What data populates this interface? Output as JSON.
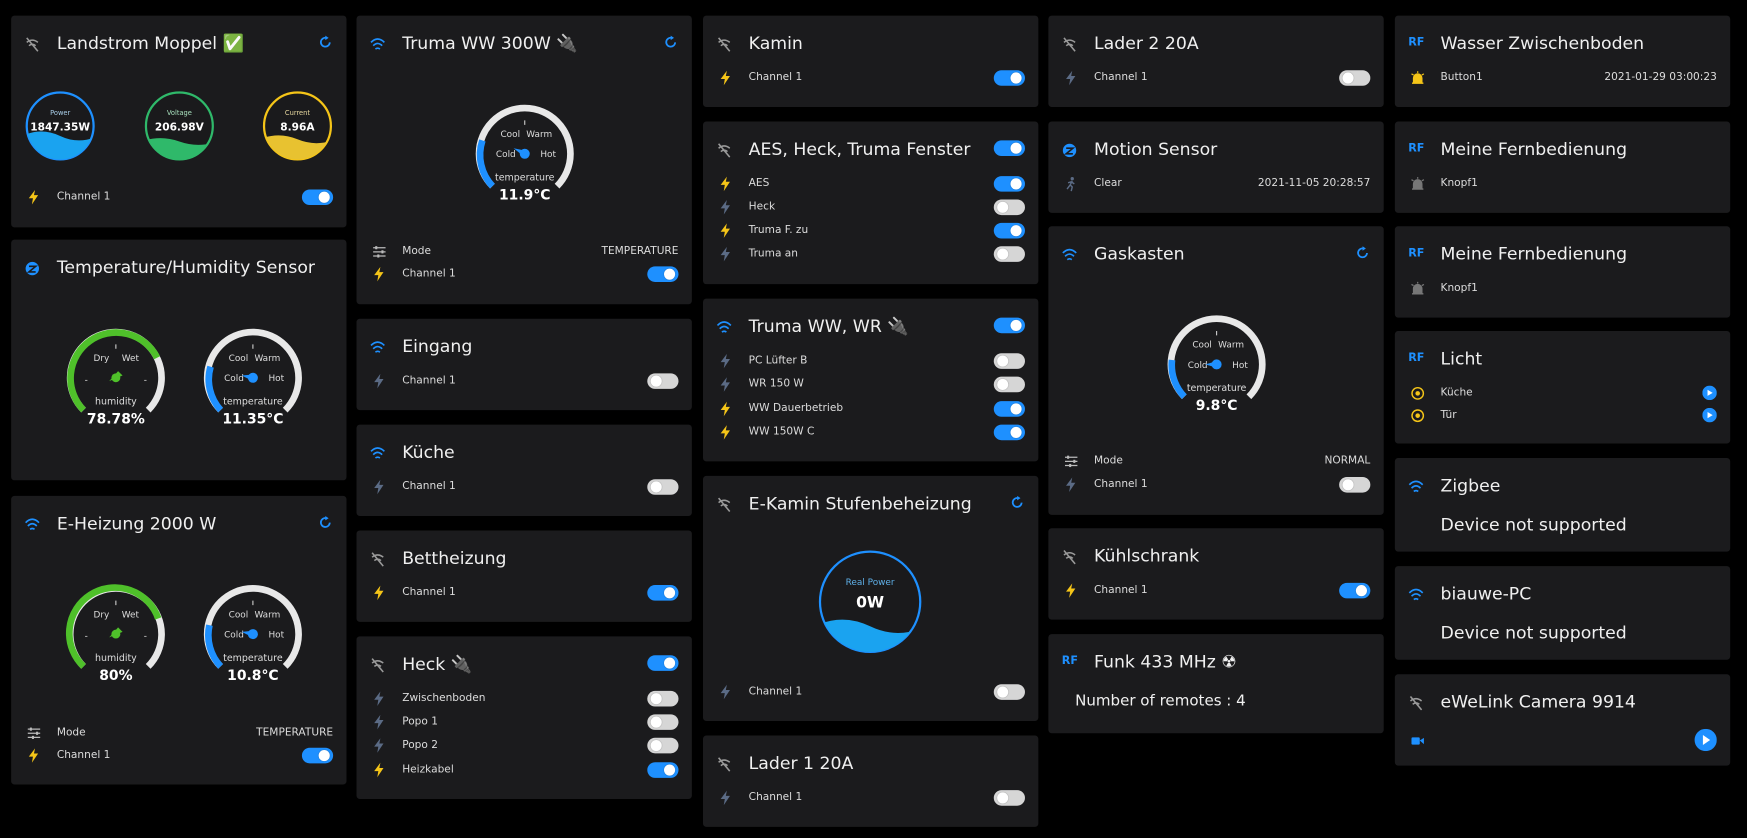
{
  "colors": {
    "accent": "#1e90ff",
    "bolt": "#f5c518",
    "card": "#1b1b1d",
    "toggle_off": "#d6d6d6"
  },
  "cards": {
    "landstrom": {
      "title": "Landstrom Moppel ✅",
      "power_label": "Power",
      "power_value": "1847.35W",
      "voltage_label": "Voltage",
      "voltage_value": "206.98V",
      "current_label": "Current",
      "current_value": "8.96A",
      "channel": "Channel 1",
      "channel_on": true
    },
    "temphum": {
      "title": "Temperature/Humidity Sensor",
      "hum_dry": "Dry",
      "hum_wet": "Wet",
      "hum_label": "humidity",
      "hum_value": "78.78%",
      "t_cool": "Cool",
      "t_warm": "Warm",
      "t_cold": "Cold",
      "t_hot": "Hot",
      "t_label": "temperature",
      "t_value": "11.35°C"
    },
    "eheizung": {
      "title": "E-Heizung 2000 W",
      "hum_dry": "Dry",
      "hum_wet": "Wet",
      "hum_label": "humidity",
      "hum_value": "80%",
      "t_cool": "Cool",
      "t_warm": "Warm",
      "t_cold": "Cold",
      "t_hot": "Hot",
      "t_label": "temperature",
      "t_value": "10.8°C",
      "mode_label": "Mode",
      "mode_value": "TEMPERATURE",
      "channel": "Channel 1",
      "channel_on": true
    },
    "truma300": {
      "title": "Truma WW 300W 🔌",
      "t_cool": "Cool",
      "t_warm": "Warm",
      "t_cold": "Cold",
      "t_hot": "Hot",
      "t_label": "temperature",
      "t_value": "11.9°C",
      "mode_label": "Mode",
      "mode_value": "TEMPERATURE",
      "channel": "Channel 1",
      "channel_on": true
    },
    "eingang": {
      "title": "Eingang",
      "channel": "Channel 1",
      "channel_on": false
    },
    "kueche": {
      "title": "Küche",
      "channel": "Channel 1",
      "channel_on": false
    },
    "bettheizung": {
      "title": "Bettheizung",
      "channel": "Channel 1",
      "channel_on": true
    },
    "heck": {
      "title": "Heck 🔌",
      "master_on": true,
      "channels": [
        {
          "label": "Zwischenboden",
          "on": false
        },
        {
          "label": "Popo 1",
          "on": false
        },
        {
          "label": "Popo 2",
          "on": false
        },
        {
          "label": "Heizkabel",
          "on": true
        }
      ]
    },
    "kamin": {
      "title": "Kamin",
      "channel": "Channel 1",
      "channel_on": true
    },
    "aes": {
      "title": "AES, Heck, Truma Fenster",
      "master_on": true,
      "channels": [
        {
          "label": "AES",
          "on": true
        },
        {
          "label": "Heck",
          "on": false
        },
        {
          "label": "Truma F. zu",
          "on": true
        },
        {
          "label": "Truma an",
          "on": false
        }
      ]
    },
    "trumawr": {
      "title": "Truma WW, WR 🔌",
      "master_on": true,
      "channels": [
        {
          "label": "PC Lüfter B",
          "on": false
        },
        {
          "label": "WR 150 W",
          "on": false
        },
        {
          "label": "WW Dauerbetrieb",
          "on": true
        },
        {
          "label": "WW 150W C",
          "on": true
        }
      ]
    },
    "ekamin": {
      "title": "E-Kamin Stufenbeheizung",
      "power_label": "Real Power",
      "power_value": "0W",
      "channel": "Channel 1",
      "channel_on": false
    },
    "lader1": {
      "title": "Lader 1 20A",
      "channel": "Channel 1",
      "channel_on": false
    },
    "lader2": {
      "title": "Lader 2 20A",
      "channel": "Channel 1",
      "channel_on": false
    },
    "motion": {
      "title": "Motion Sensor",
      "status": "Clear",
      "time": "2021-11-05 20:28:57"
    },
    "gaskasten": {
      "title": "Gaskasten",
      "t_cool": "Cool",
      "t_warm": "Warm",
      "t_cold": "Cold",
      "t_hot": "Hot",
      "t_label": "temperature",
      "t_value": "9.8°C",
      "mode_label": "Mode",
      "mode_value": "NORMAL",
      "channel": "Channel 1",
      "channel_on": false
    },
    "kuehlschrank": {
      "title": "Kühlschrank",
      "channel": "Channel 1",
      "channel_on": true
    },
    "funk": {
      "title": "Funk 433 MHz ☢",
      "remotes_text": "Number of remotes : 4"
    },
    "wasser": {
      "title": "Wasser Zwischenboden",
      "button": "Button1",
      "time": "2021-01-29 03:00:23"
    },
    "fern1": {
      "title": "Meine Fernbedienung",
      "button": "Knopf1"
    },
    "fern2": {
      "title": "Meine Fernbedienung",
      "button": "Knopf1"
    },
    "licht": {
      "title": "Licht",
      "items": [
        {
          "label": "Küche"
        },
        {
          "label": "Tür"
        }
      ]
    },
    "zigbee": {
      "title": "Zigbee",
      "message": "Device not supported"
    },
    "biauwe": {
      "title": "biauwe-PC",
      "message": "Device not supported"
    },
    "camera": {
      "title": "eWeLink Camera 9914"
    }
  },
  "rf_badge": "RF"
}
